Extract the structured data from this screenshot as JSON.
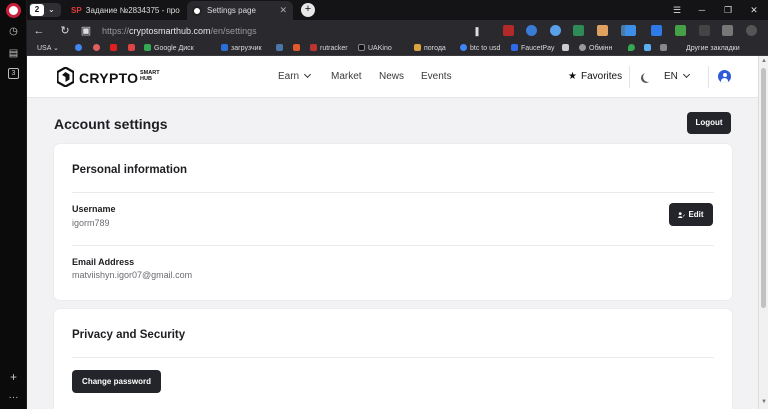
{
  "browser": {
    "tab_count": "2",
    "tabs": [
      {
        "label": "Задание №2834375 - про",
        "favicon": "SP"
      },
      {
        "label": "Settings page"
      }
    ],
    "url_scheme": "https://",
    "url_host": "cryptosmarthub.com",
    "url_path": "/en/settings",
    "bookmarks": [
      {
        "label": "USA"
      },
      {
        "label": "Google Диск"
      },
      {
        "label": "загрузчик"
      },
      {
        "label": "rutracker"
      },
      {
        "label": "UAKino"
      },
      {
        "label": "погода"
      },
      {
        "label": "btc to usd"
      },
      {
        "label": "FaucetPay"
      },
      {
        "label": "Обмінн"
      }
    ],
    "other_bookmarks": "Другие закладки"
  },
  "site": {
    "brand_word": "CRYPTO",
    "brand_sub_1": "SMART",
    "brand_sub_2": "HUB",
    "nav": [
      "Earn",
      "Market",
      "News",
      "Events"
    ],
    "favorites_label": "Favorites",
    "language": "EN"
  },
  "page": {
    "title": "Account settings",
    "logout_label": "Logout",
    "personal": {
      "title": "Personal information",
      "username_label": "Username",
      "username_value": "igorm789",
      "edit_label": "Edit",
      "email_label": "Email Address",
      "email_value": "matviishyn.igor07@gmail.com"
    },
    "privacy": {
      "title": "Privacy and Security",
      "change_password_label": "Change password"
    }
  },
  "colors": {
    "button_dark": "#23252b",
    "page_bg": "#f2f2f4",
    "accent_blue": "#2f5bd8"
  }
}
